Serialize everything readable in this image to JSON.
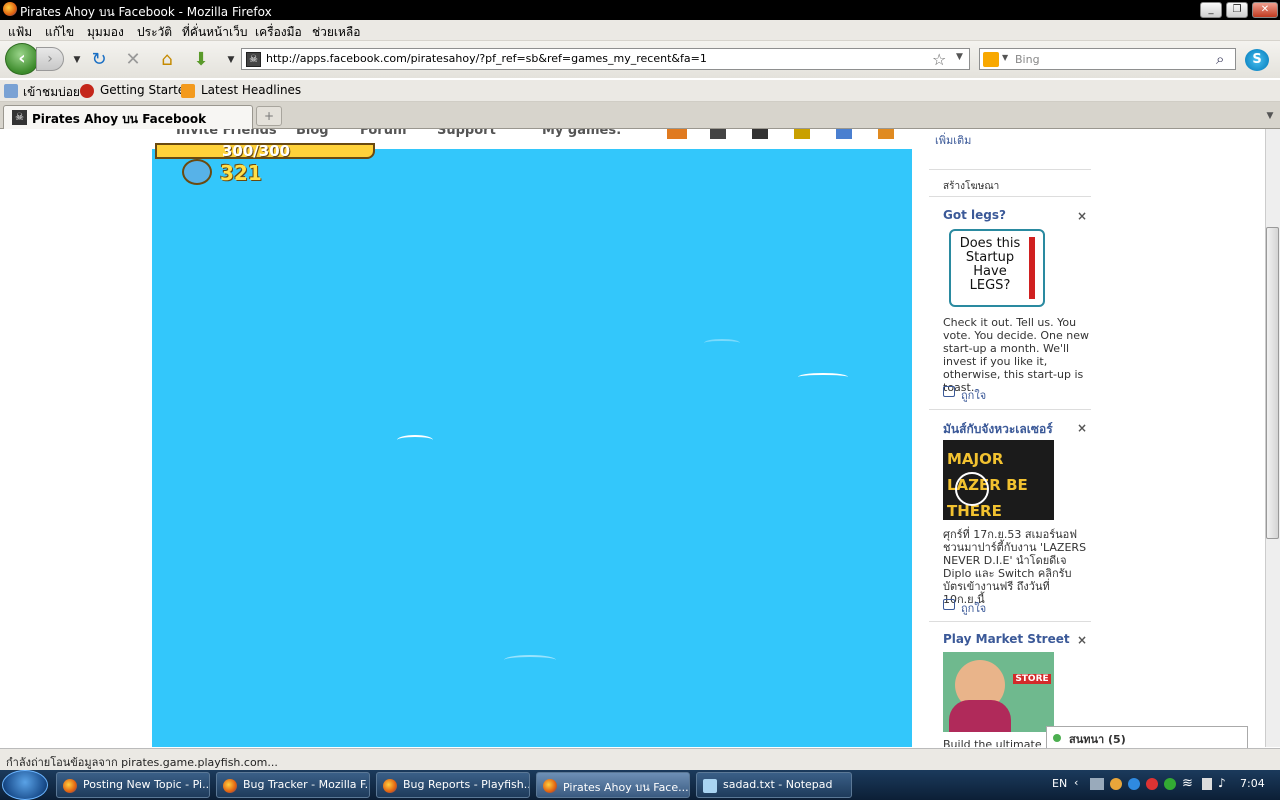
{
  "window": {
    "title": "Pirates Ahoy บน Facebook - Mozilla Firefox"
  },
  "menu": [
    "แฟ้ม",
    "แก้ไข",
    "มุมมอง",
    "ประวัติ",
    "ที่คั่นหน้าเว็บ",
    "เครื่องมือ",
    "ช่วยเหลือ"
  ],
  "nav": {
    "url": "http://apps.facebook.com/piratesahoy/?pf_ref=sb&ref=games_my_recent&fa=1",
    "search_placeholder": "Bing"
  },
  "bookmarks": [
    "เข้าชมบ่อย",
    "Getting Started",
    "Latest Headlines"
  ],
  "tabs": [
    {
      "label": "Pirates Ahoy บน Facebook"
    }
  ],
  "game": {
    "nav": [
      "Invite Friends",
      "Blog",
      "Forum",
      "Support",
      "My games:"
    ],
    "energy": "300/300",
    "coins": "321"
  },
  "sidebar": {
    "more": "เพิ่มเติม",
    "create_ad": "สร้างโฆษณา",
    "ads": [
      {
        "title": "Got legs?",
        "image_text": "Does this Startup Have LEGS?",
        "body": "Check it out. Tell us. You vote. You decide. One new start-up a month. We'll invest if you like it, otherwise, this start-up is toast.",
        "like": "ถูกใจ"
      },
      {
        "title": "มันส์กับจังหวะเลเซอร์",
        "image_text": "MAJOR LAZER BE THERE",
        "body": "ศุกร์ที่ 17ก.ย.53 สเมอร์นอฟชวนมาปาร์ตี้กับงาน 'LAZERS NEVER D.I.E' นำโดยดีเจ Diplo และ Switch คลิกรับบัตรเข้างานฟรี ถึงวันที่ 10ก.ย.นี้",
        "like": "ถูกใจ"
      },
      {
        "title": "Play Market Street",
        "image_text": "STORE",
        "body": "Build the ultimate reta",
        "like": ""
      }
    ]
  },
  "chat": {
    "label": "สนทนา (5)"
  },
  "status": {
    "text": "กำลังถ่ายโอนข้อมูลจาก pirates.game.playfish.com..."
  },
  "taskbar": {
    "tasks": [
      "Posting New Topic - Pi...",
      "Bug Tracker - Mozilla F...",
      "Bug Reports - Playfish...",
      "Pirates Ahoy บน Face...",
      "sadad.txt - Notepad"
    ],
    "lang": "EN",
    "clock": "7:04"
  }
}
